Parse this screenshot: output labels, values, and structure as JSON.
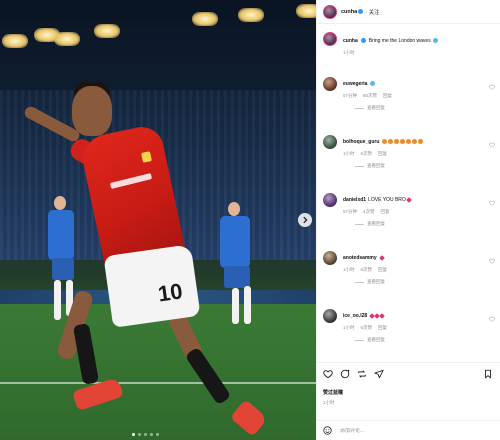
{
  "post": {
    "author": "cunha",
    "follow_label": "· 关注",
    "caption_text": "Bring me the London waves",
    "caption_time": "1小时",
    "image_count": 5,
    "active_image_index": 0
  },
  "comments": [
    {
      "user": "euwegeria",
      "text": "",
      "emoji": [
        "e-wave"
      ],
      "meta": [
        "57分钟",
        "80次赞",
        "回复"
      ],
      "replies": "查看回复"
    },
    {
      "user": "bolhoque_guru",
      "text": "",
      "emoji": [
        "e-fire",
        "e-fire",
        "e-fire",
        "e-fire",
        "e-fire",
        "e-fire",
        "e-fire"
      ],
      "meta": [
        "1小时",
        "6次赞",
        "回复"
      ],
      "replies": "查看回复"
    },
    {
      "user": "danielxd1",
      "text": "LOVE YOU BRO",
      "emoji": [
        "e-heart"
      ],
      "meta": [
        "57分钟",
        "4次赞",
        "回复"
      ],
      "replies": "查看回复"
    },
    {
      "user": "anotedsammy",
      "text": "",
      "emoji": [
        "e-heart"
      ],
      "meta": [
        "1小时",
        "6次赞",
        "回复"
      ],
      "replies": "查看回复"
    },
    {
      "user": "ice_oo.l28",
      "text": "",
      "emoji": [
        "e-heart",
        "e-heart",
        "e-heart"
      ],
      "meta": [
        "1小时",
        "6次赞",
        "回复"
      ],
      "replies": "查看回复"
    }
  ],
  "actions": {
    "likes_label": "赞过蓝瞳",
    "time_label": "1小时"
  },
  "add_comment": {
    "placeholder": "添加评论..."
  },
  "colors": {
    "verified": "#3897f0",
    "heart": "#e6356a",
    "kit_red": "#d0221a"
  }
}
